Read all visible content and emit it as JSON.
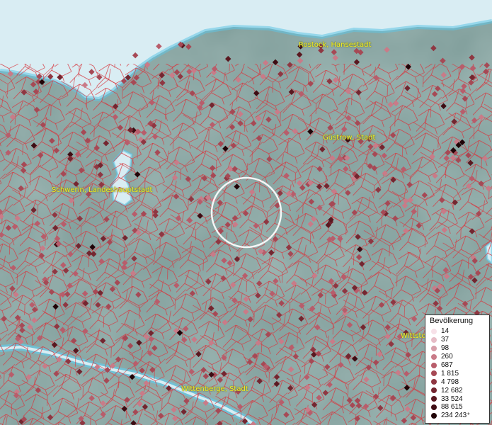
{
  "map": {
    "cities": [
      {
        "label": "Rostock, Hansestadt"
      },
      {
        "label": "Güstrow, Stadt"
      },
      {
        "label": "Schwerin, Landeshauptstadt"
      },
      {
        "label": "Wittenberge, Stadt"
      },
      {
        "label": "Wittsto"
      }
    ],
    "colors": {
      "land": "#7f9d9a",
      "water": "#d9edf3",
      "boundary": "#d6373f",
      "label": "#f4ef2a",
      "selection_ring": "#ffffff"
    }
  },
  "legend": {
    "title": "Bevölkerung",
    "items": [
      {
        "label": "14",
        "color": "#f7e1e8"
      },
      {
        "label": "37",
        "color": "#e6bcc6"
      },
      {
        "label": "98",
        "color": "#d79ea9"
      },
      {
        "label": "260",
        "color": "#c97b88"
      },
      {
        "label": "687",
        "color": "#b85d6b"
      },
      {
        "label": "1 815",
        "color": "#a64955"
      },
      {
        "label": "4 798",
        "color": "#8f3742"
      },
      {
        "label": "12 682",
        "color": "#742630"
      },
      {
        "label": "33 524",
        "color": "#5a1820"
      },
      {
        "label": "88 615",
        "color": "#3e0c13"
      },
      {
        "label": "234 243⁺",
        "color": "#200307"
      }
    ]
  }
}
